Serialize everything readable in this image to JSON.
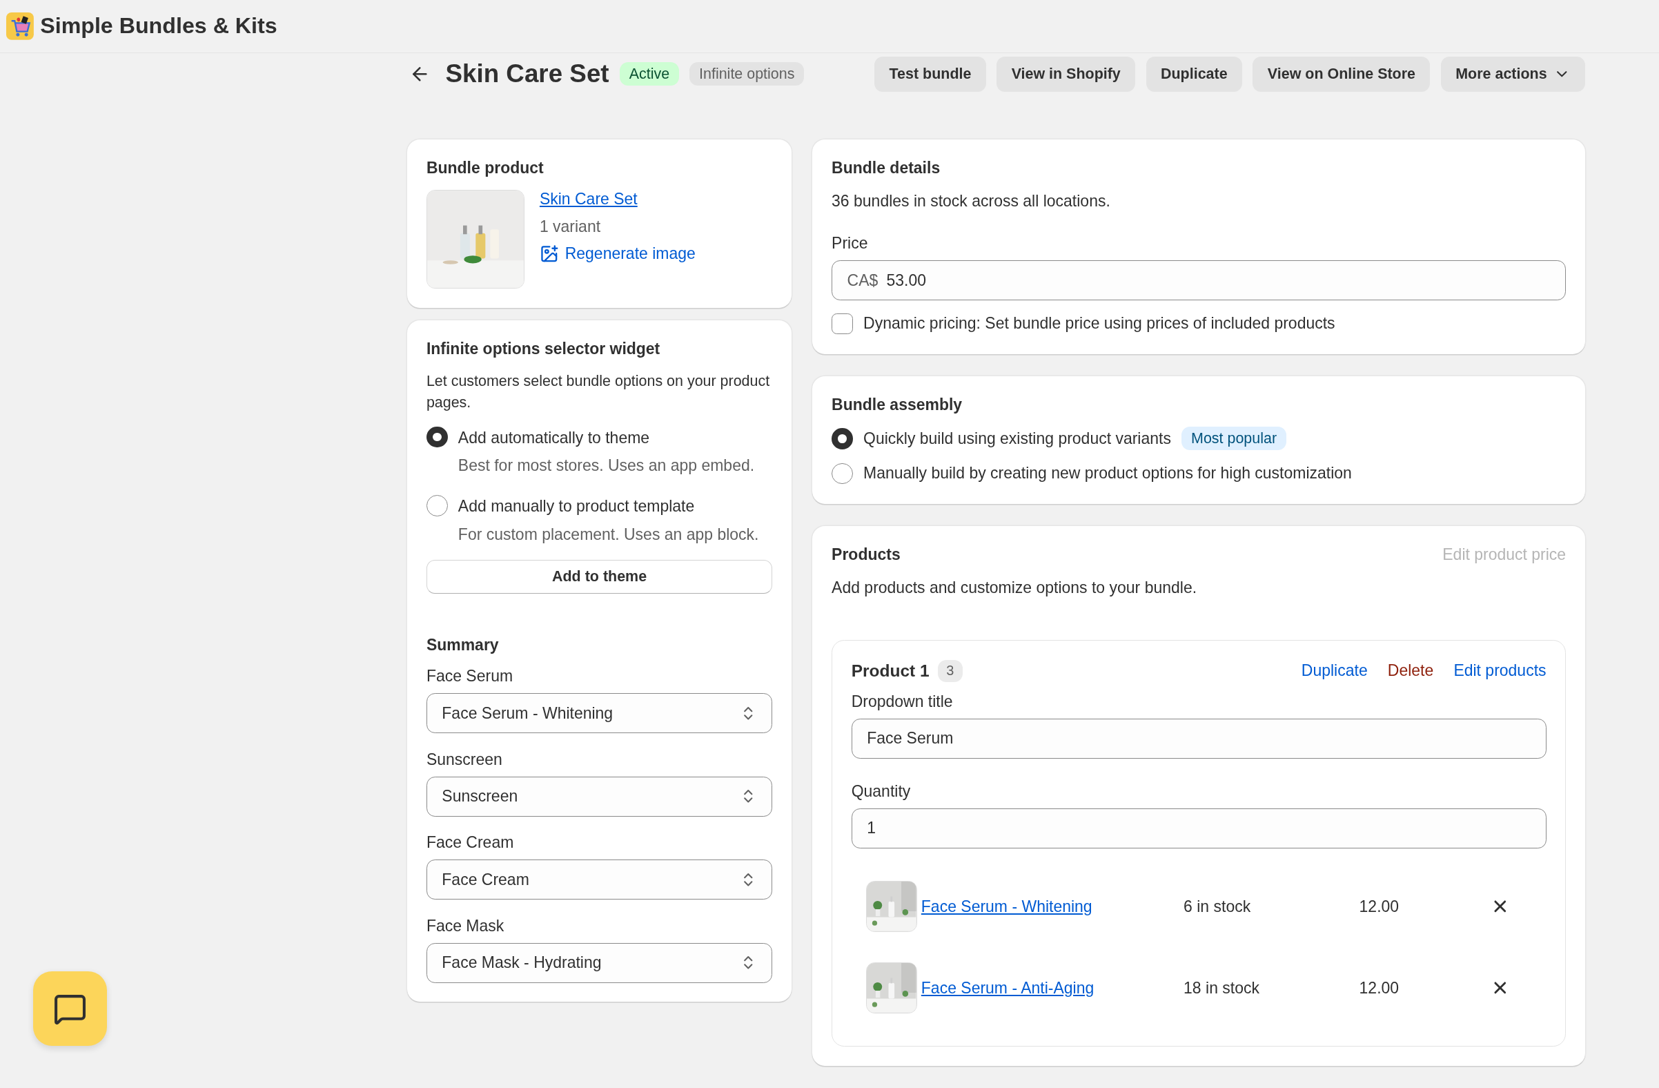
{
  "app": {
    "title": "Simple Bundles & Kits"
  },
  "page": {
    "title": "Skin Care Set",
    "badges": [
      {
        "label": "Active",
        "kind": "success"
      },
      {
        "label": "Infinite options",
        "kind": "neutral"
      }
    ],
    "actions": [
      {
        "label": "Test bundle",
        "kind": "plain"
      },
      {
        "label": "View in Shopify",
        "kind": "plain"
      },
      {
        "label": "Duplicate",
        "kind": "plain"
      },
      {
        "label": "View on Online Store",
        "kind": "plain"
      },
      {
        "label": "More actions",
        "kind": "menu"
      }
    ]
  },
  "bundle_product": {
    "heading": "Bundle product",
    "product_link": "Skin Care Set",
    "variant_count": "1 variant",
    "regenerate_link": "Regenerate image"
  },
  "widget": {
    "heading": "Infinite options selector widget",
    "description": "Let customers select bundle options on your product pages.",
    "options": [
      {
        "label": "Add automatically to theme",
        "help": "Best for most stores. Uses an app embed.",
        "selected": true
      },
      {
        "label": "Add manually to product template",
        "help": "For custom placement. Uses an app block.",
        "selected": false
      }
    ],
    "button": "Add to theme"
  },
  "summary": {
    "heading": "Summary",
    "fields": [
      {
        "label": "Face Serum",
        "value": "Face Serum - Whitening"
      },
      {
        "label": "Sunscreen",
        "value": "Sunscreen"
      },
      {
        "label": "Face Cream",
        "value": "Face Cream"
      },
      {
        "label": "Face Mask",
        "value": "Face Mask - Hydrating"
      }
    ]
  },
  "bundle_details": {
    "heading": "Bundle details",
    "stock_text": "36 bundles in stock across all locations.",
    "price": {
      "label": "Price",
      "prefix": "CA$",
      "value": "53.00"
    },
    "dynamic_pricing": {
      "label": "Dynamic pricing: Set bundle price using prices of included products",
      "checked": false
    }
  },
  "bundle_assembly": {
    "heading": "Bundle assembly",
    "options": [
      {
        "label": "Quickly build using existing product variants",
        "badge": "Most popular",
        "selected": true
      },
      {
        "label": "Manually build by creating new product options for high customization",
        "selected": false
      }
    ]
  },
  "products": {
    "heading": "Products",
    "edit_price": {
      "label": "Edit product price",
      "disabled": true
    },
    "description": "Add products and customize options to your bundle.",
    "groups": [
      {
        "title": "Product 1",
        "count": "3",
        "actions": [
          {
            "label": "Duplicate",
            "kind": "link"
          },
          {
            "label": "Delete",
            "kind": "danger"
          },
          {
            "label": "Edit products",
            "kind": "link"
          }
        ],
        "dropdown_title": {
          "label": "Dropdown title",
          "value": "Face Serum"
        },
        "quantity": {
          "label": "Quantity",
          "value": "1"
        },
        "items": [
          {
            "name": "Face Serum - Whitening",
            "stock": "6 in stock",
            "price": "12.00"
          },
          {
            "name": "Face Serum - Anti-Aging",
            "stock": "18 in stock",
            "price": "12.00"
          }
        ]
      }
    ]
  }
}
